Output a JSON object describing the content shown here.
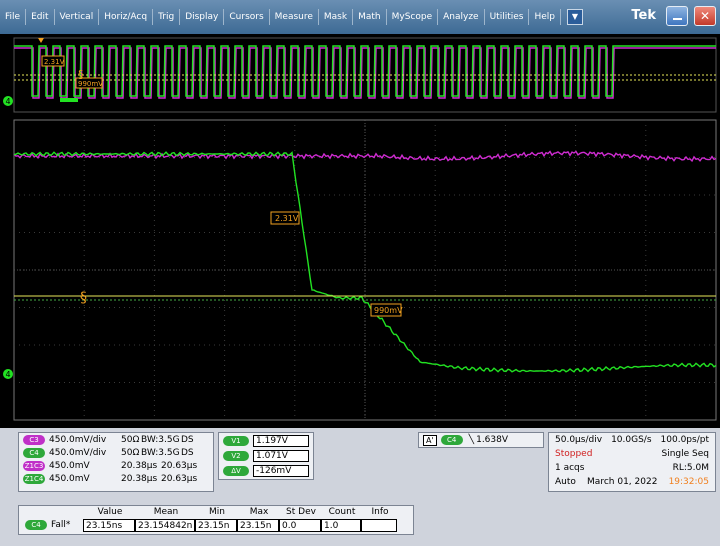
{
  "menu": [
    "File",
    "Edit",
    "Vertical",
    "Horiz/Acq",
    "Trig",
    "Display",
    "Cursors",
    "Measure",
    "Mask",
    "Math",
    "MyScope",
    "Analyze",
    "Utilities",
    "Help"
  ],
  "brand": "Tek",
  "scope": {
    "overview_label_top": "2.31V",
    "overview_label_mid": "990mV",
    "main_label_upper": "2.31V",
    "main_label_lower": "990mV",
    "ch_marker": "4",
    "colors": {
      "ch3": "#d02cd2",
      "ch4": "#22e222",
      "grid": "#6a6a6a",
      "cursor": "#f0a020"
    }
  },
  "channels": [
    {
      "badge": "C3",
      "scale": "450.0mV/div",
      "imp": "50Ω",
      "bw": "BW:3.5G",
      "ds": "DS",
      "color": "magenta"
    },
    {
      "badge": "C4",
      "scale": "450.0mV/div",
      "imp": "50Ω",
      "bw": "BW:3.5G",
      "ds": "DS",
      "color": "green"
    },
    {
      "badge": "Z1C3",
      "scale": "450.0mV",
      "t1": "20.38µs",
      "t2": "20.63µs",
      "color": "magenta"
    },
    {
      "badge": "Z1C4",
      "scale": "450.0mV",
      "t1": "20.38µs",
      "t2": "20.63µs",
      "color": "green"
    }
  ],
  "cursors": [
    {
      "label": "V1",
      "value": "1.197V"
    },
    {
      "label": "V2",
      "value": "1.071V"
    },
    {
      "label": "ΔV",
      "value": "-126mV"
    }
  ],
  "trigger": {
    "tag": "A'",
    "ch": "C4",
    "value": "1.638V"
  },
  "acq": {
    "timebase": "50.0µs/div",
    "rate": "10.0GS/s",
    "res": "100.0ps/pt",
    "state": "Stopped",
    "mode": "Single Seq",
    "acqs": "1 acqs",
    "rl": "RL:5.0M",
    "trig_mode": "Auto",
    "date": "March 01, 2022",
    "time": "19:32:05"
  },
  "measurement": {
    "headers": [
      "Value",
      "Mean",
      "Min",
      "Max",
      "St Dev",
      "Count",
      "Info"
    ],
    "row": {
      "ch": "C4",
      "name": "Fall*",
      "value": "23.15ns",
      "mean": "23.154842n",
      "min": "23.15n",
      "max": "23.15n",
      "stdev": "0.0",
      "count": "1.0",
      "info": ""
    }
  }
}
